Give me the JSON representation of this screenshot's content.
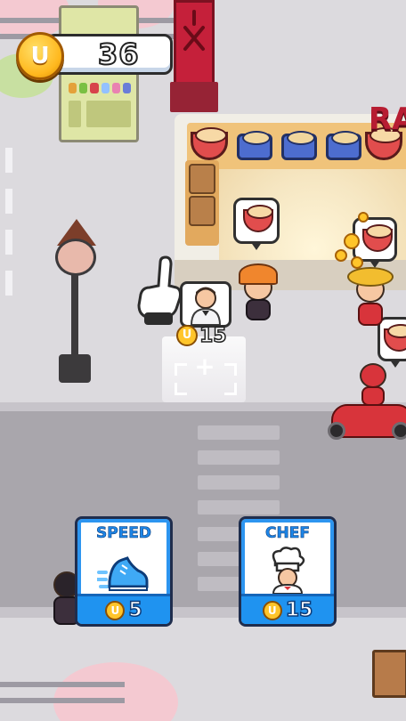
{
  "hud": {
    "coin_glyph": "U",
    "coin_count": "36"
  },
  "shop": {
    "sign_text": "RA"
  },
  "hire_spot": {
    "coin_glyph": "U",
    "price": "15"
  },
  "upgrades": [
    {
      "title": "SPEED",
      "coin_glyph": "U",
      "price": "5",
      "icon": "sneaker-icon"
    },
    {
      "title": "CHEF",
      "coin_glyph": "U",
      "price": "15",
      "icon": "chef-icon"
    }
  ],
  "colors": {
    "card_accent": "#1f93f0",
    "coin_gold": "#ffc52b",
    "shop_red": "#c5203a"
  }
}
